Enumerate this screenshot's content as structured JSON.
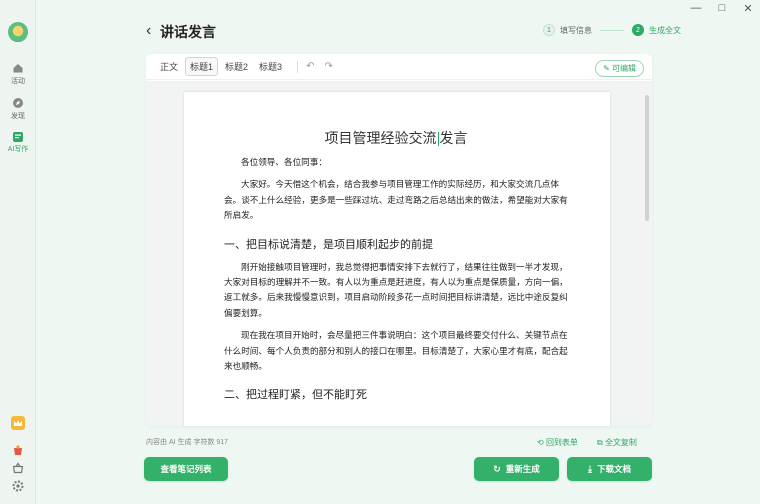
{
  "window": {
    "minimize": "—",
    "maximize": "□",
    "close": "✕"
  },
  "sidebar": {
    "items": [
      {
        "label": "活动",
        "icon": "home-icon"
      },
      {
        "label": "发现",
        "icon": "compass-icon"
      },
      {
        "label": "AI写作",
        "icon": "ai-write-icon",
        "active": true
      }
    ]
  },
  "header": {
    "back": "‹",
    "title": "讲话发言",
    "steps": [
      {
        "num": "1",
        "label": "填写信息"
      },
      {
        "num": "2",
        "label": "生成全文"
      }
    ]
  },
  "toolbar": {
    "items": [
      "正文",
      "标题1",
      "标题2",
      "标题3"
    ],
    "active": "标题1",
    "undo": "↶",
    "redo": "↷",
    "editable": "可编辑"
  },
  "document": {
    "title_before": "项目管理经验交流",
    "title_after": "发言",
    "salutation": "各位领导、各位同事：",
    "para1": "大家好。今天借这个机会，结合我参与项目管理工作的实际经历，和大家交流几点体会。谈不上什么经验，更多是一些踩过坑、走过弯路之后总结出来的做法，希望能对大家有所启发。",
    "heading1": "一、把目标说清楚，是项目顺利起步的前提",
    "para2": "刚开始接触项目管理时，我总觉得把事情安排下去就行了，结果往往做到一半才发现，大家对目标的理解并不一致。有人以为重点是赶进度，有人以为重点是保质量，方向一偏，返工就多。后来我慢慢意识到，项目启动阶段多花一点时间把目标讲清楚，远比中途反复纠偏要划算。",
    "para3": "现在我在项目开始时，会尽量把三件事说明白：这个项目最终要交付什么、关键节点在什么时间、每个人负责的部分和别人的接口在哪里。目标清楚了，大家心里才有底，配合起来也顺畅。",
    "heading2": "二、把过程盯紧，但不能盯死"
  },
  "footer": {
    "meta": "内容由 AI 生成   字符数 917",
    "back_to_form": "回到表单",
    "copy_all": "全文复制",
    "notes_button": "查看笔记列表",
    "regenerate_button": "重新生成",
    "download_button": "下载文档"
  }
}
